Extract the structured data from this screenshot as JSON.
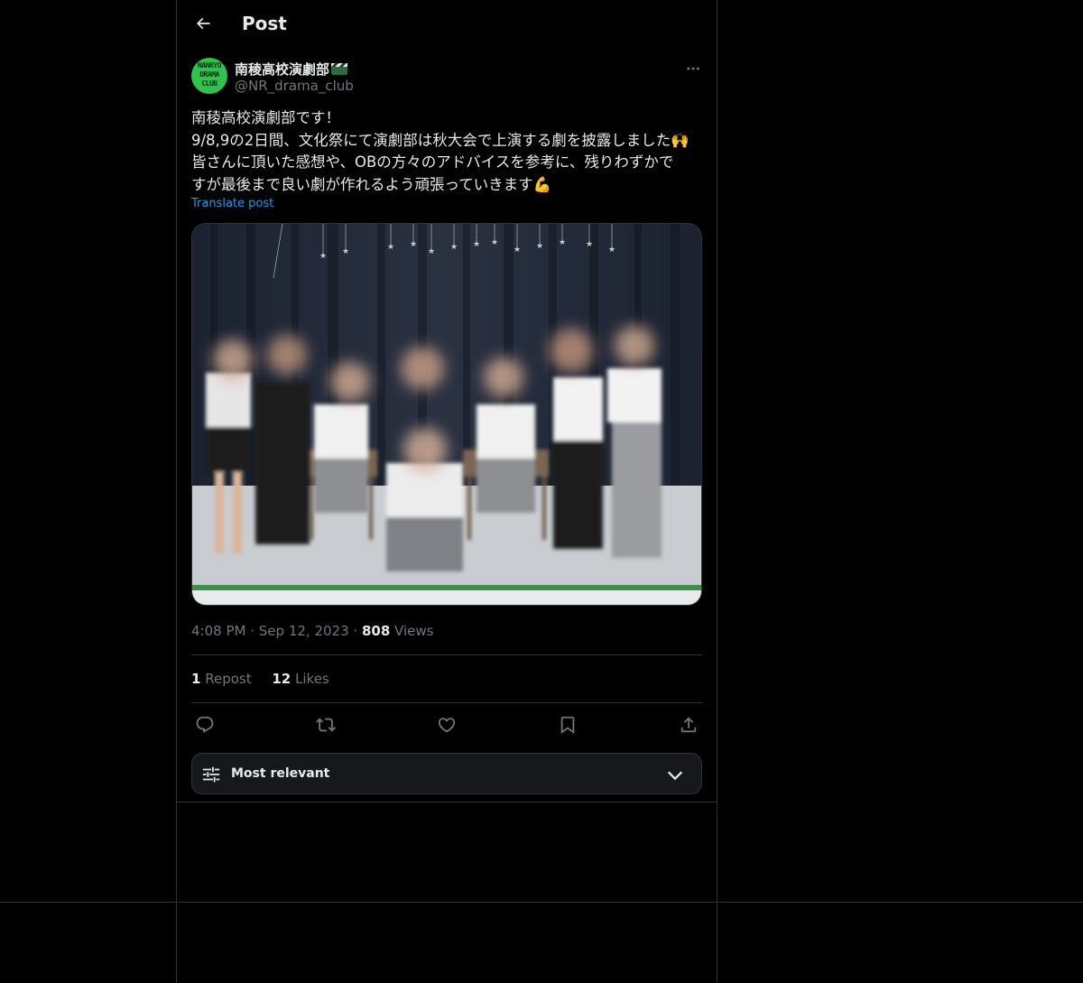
{
  "header": {
    "title": "Post"
  },
  "author": {
    "display_name": "南稜高校演劇部",
    "handle": "@NR_drama_club",
    "avatar_text": "NANRYO DRAMA CLUB"
  },
  "post": {
    "text": "南稜高校演劇部です！\n9/8,9の2日間、文化祭にて演劇部は秋大会で上演する劇を披露しました🙌\n皆さんに頂いた感想や、OBの方々のアドバイスを参考に、残りわずかで\nすが最後まで良い劇が作れるよう頑張っていきます💪",
    "translate_label": "Translate post"
  },
  "meta": {
    "time": "4:08 PM",
    "date": "Sep 12, 2023",
    "views_count": "808",
    "views_label": "Views"
  },
  "stats": {
    "reposts_count": "1",
    "reposts_label": "Repost",
    "likes_count": "12",
    "likes_label": "Likes"
  },
  "actions": {
    "icons": [
      "reply-icon",
      "repost-icon",
      "like-icon",
      "bookmark-icon",
      "share-icon"
    ]
  },
  "sort": {
    "label": "Most relevant"
  },
  "colors": {
    "accent": "#1d9bf0",
    "border": "#2f3336",
    "muted": "#71767b",
    "avatar_bg": "#2dc34d"
  }
}
